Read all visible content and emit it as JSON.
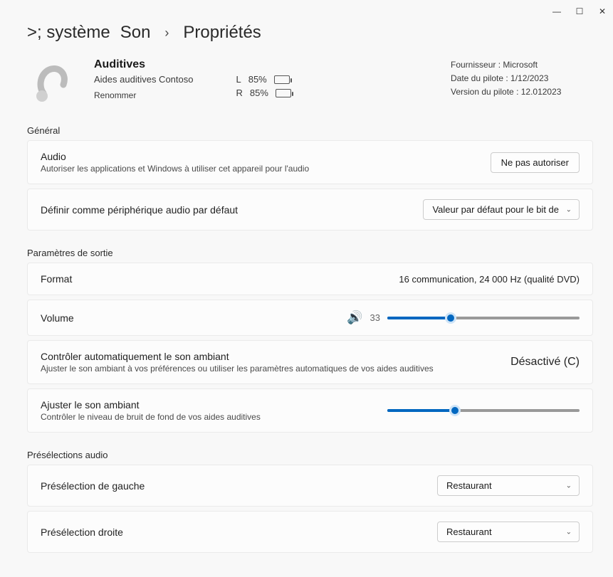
{
  "titlebar": {
    "min": "—",
    "max": "☐",
    "close": "✕"
  },
  "breadcrumb": {
    "gt": ">; système",
    "sound": "Son",
    "props": "Propriétés"
  },
  "device": {
    "name": "Auditives",
    "vendor_line": "Aides auditives Contoso",
    "rename": "Renommer",
    "battery_l_label": "L",
    "battery_l_pct": "85%",
    "battery_r_label": "R",
    "battery_r_pct": "85%"
  },
  "meta": {
    "provider": "Fournisseur : Microsoft",
    "driver_date": "Date du pilote : 1/12/2023",
    "driver_ver": "Version du pilote : 12.012023"
  },
  "sections": {
    "general": "Général",
    "output": "Paramètres de sortie",
    "presets": "Présélections audio"
  },
  "audio_card": {
    "title": "Audio",
    "sub": "Autoriser les applications et Windows à utiliser cet appareil pour l'audio",
    "button": "Ne pas autoriser"
  },
  "default_card": {
    "title": "Définir comme périphérique audio par défaut",
    "select": "Valeur par défaut pour le bit de"
  },
  "format_card": {
    "title": "Format",
    "value": "16 communication, 24 000 Hz (qualité DVD)"
  },
  "volume_card": {
    "title": "Volume",
    "value": "33",
    "pct": 33
  },
  "ambient_ctrl": {
    "title": "Contrôler automatiquement le son ambiant",
    "sub": "Ajuster le son ambiant à vos préférences ou utiliser les paramètres automatiques de vos aides auditives",
    "state": "Désactivé (C)"
  },
  "ambient_adj": {
    "title": "Ajuster le son ambiant",
    "sub": "Contrôler le niveau de bruit de fond de vos aides auditives",
    "pct": 35
  },
  "preset_left": {
    "title": "Présélection de gauche",
    "value": "Restaurant"
  },
  "preset_right": {
    "title": "Présélection droite",
    "value": "Restaurant"
  }
}
